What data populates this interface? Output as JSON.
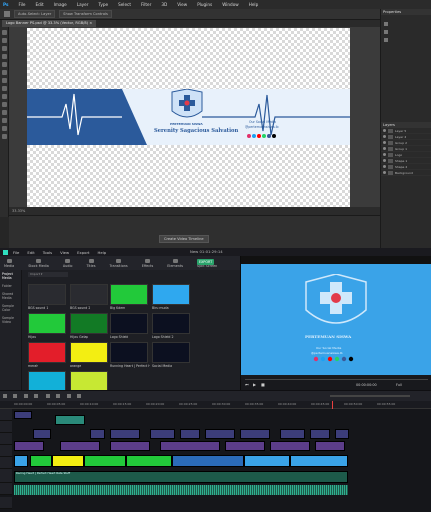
{
  "photoshop": {
    "menu": [
      "Ps",
      "File",
      "Edit",
      "Image",
      "Layer",
      "Type",
      "Select",
      "Filter",
      "3D",
      "View",
      "Plugins",
      "Window",
      "Help"
    ],
    "options": [
      "Auto-Select: Layer",
      "Show Transform Controls"
    ],
    "document_tab": "Logo Banner PS.psd @ 33.3% (Vector, RGB/8) ×",
    "status": "33.33%",
    "timeline_button": "Create Video Timeline",
    "right_panels": {
      "properties_title": "Properties",
      "layers_title": "Layers",
      "layers": [
        "Layer 5",
        "Layer 4",
        "Group 2",
        "Group 1",
        "Logo",
        "Shape 1",
        "Shape 2",
        "Background"
      ]
    },
    "banner": {
      "title": "Serenity Sagacious Salvation",
      "social_title": "Our Social Media",
      "social_handle": "@pertemuansiswa.lb",
      "logo_caption": "PERTEMUAN SISWA"
    }
  },
  "filmora": {
    "menu": [
      "File",
      "Edit",
      "Tools",
      "View",
      "Export",
      "Help"
    ],
    "title": "New 01:01:29:14",
    "tabs": [
      "Media",
      "Stock Media",
      "Audio",
      "Titles",
      "Transitions",
      "Effects",
      "Elements",
      "Split Screen"
    ],
    "export_label": "EXPORT",
    "left_tree": [
      "Project Media",
      "Folder",
      "Shared Media",
      "Sample Color",
      "Sample Video"
    ],
    "media_items": [
      {
        "label": "BGS sound 1",
        "color": "#2a2b30"
      },
      {
        "label": "BGS sound 2",
        "color": "#2a2b30"
      },
      {
        "label": "Big Kdem",
        "color": "#22c93a"
      },
      {
        "label": "Biru muda",
        "color": "#2fa8ef"
      },
      {
        "label": "Hijau",
        "color": "#22c93a"
      },
      {
        "label": "Hijau Gelap",
        "color": "#127a25"
      },
      {
        "label": "Logo Shield",
        "color": "#0c1020"
      },
      {
        "label": "Logo Shield 2",
        "color": "#0c1020"
      },
      {
        "label": "merah",
        "color": "#e31e2a"
      },
      {
        "label": "orange",
        "color": "#f3ee12"
      },
      {
        "label": "Running Heart | Perfect Heart Rate Stuff",
        "color": "#0c1020"
      },
      {
        "label": "Social Media",
        "color": "#0c1020"
      },
      {
        "label": "",
        "color": "#12b0d8"
      },
      {
        "label": "",
        "color": "#c7e833"
      }
    ],
    "preview": {
      "logo_caption": "PERTEMUAN SISWA",
      "social_title": "Our Social Media",
      "social_handle": "@pertemuansiswa.lb",
      "timecode": "00:00:00:00",
      "zoom": "Full"
    },
    "ruler_ticks": [
      "00:00:00:00",
      "00:00:05:00",
      "00:00:10:00",
      "00:00:15:00",
      "00:00:20:00",
      "00:00:25:00",
      "00:00:30:00",
      "00:00:35:00",
      "00:00:40:00",
      "00:00:45:00",
      "00:00:50:00",
      "00:00:55:00"
    ],
    "audio_clip_label": "Racing Heart | Perfect Heart Rate Stuff"
  },
  "colors": {
    "banner_blue": "#2b5a9b",
    "preview_blue": "#3aa3e8",
    "green": "#22c93a",
    "yellow": "#f3ee12",
    "playhead": "#e84040"
  }
}
